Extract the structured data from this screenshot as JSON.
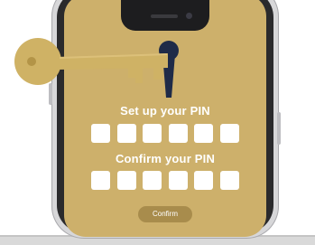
{
  "setup_pin": {
    "label": "Set up your PIN",
    "digit_count": 6
  },
  "confirm_pin": {
    "label": "Confirm your PIN",
    "digit_count": 6
  },
  "actions": {
    "confirm_label": "Confirm"
  },
  "colors": {
    "screen": "#cdb06b",
    "key": "#cfb265",
    "keyhole": "#1f2b48",
    "button": "#a88c4c",
    "text": "#ffffff"
  },
  "icons": {
    "key": "key-icon",
    "keyhole": "keyhole-icon"
  }
}
